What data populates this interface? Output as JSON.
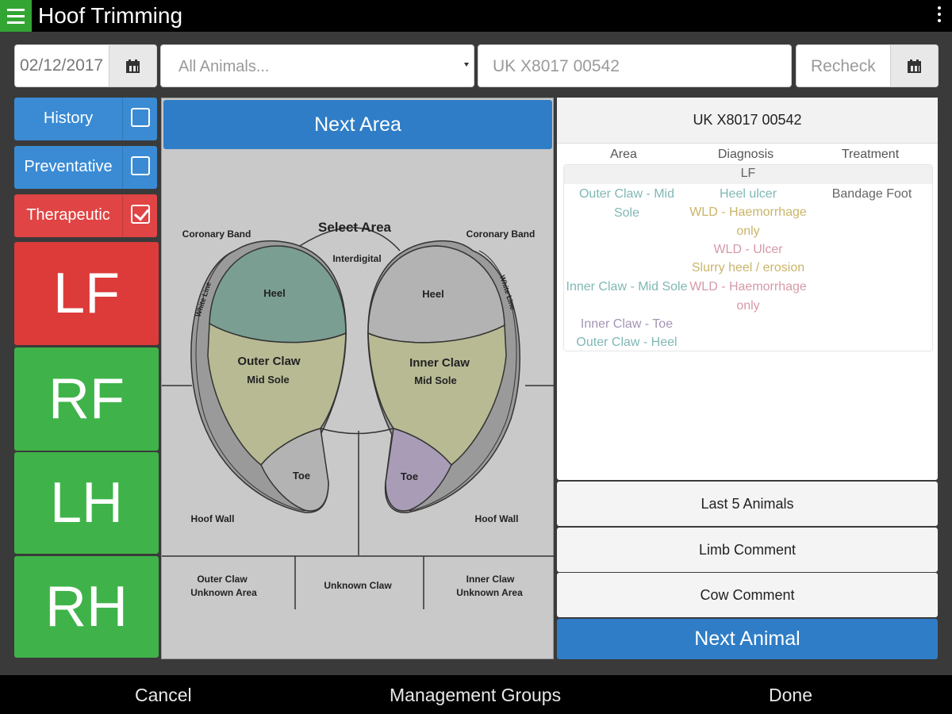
{
  "app": {
    "title": "Hoof Trimming"
  },
  "top_row": {
    "date_value": "02/12/2017",
    "animal_select_value": "All Animals...",
    "animal_id_value": "UK X8017 00542",
    "recheck_placeholder": "Recheck"
  },
  "categories": [
    {
      "label": "History",
      "checked": false
    },
    {
      "label": "Preventative",
      "checked": false
    },
    {
      "label": "Therapeutic",
      "checked": true
    }
  ],
  "limbs": [
    "LF",
    "RF",
    "LH",
    "RH"
  ],
  "diagram": {
    "next_area_label": "Next Area",
    "select_area": "Select Area",
    "coronary_band_left": "Coronary Band",
    "coronary_band_right": "Coronary Band",
    "interdigital": "Interdigital",
    "white_line_left": "White Line",
    "white_line_right": "White Line",
    "heel_left": "Heel",
    "heel_right": "Heel",
    "outer_claw": "Outer Claw",
    "inner_claw": "Inner Claw",
    "mid_sole_left": "Mid Sole",
    "mid_sole_right": "Mid Sole",
    "toe_left": "Toe",
    "toe_right": "Toe",
    "hoof_wall_left": "Hoof Wall",
    "hoof_wall_right": "Hoof Wall",
    "outer_unknown_1": "Outer Claw",
    "outer_unknown_2": "Unknown Area",
    "unknown_claw": "Unknown Claw",
    "inner_unknown_1": "Inner Claw",
    "inner_unknown_2": "Unknown Area",
    "colors": {
      "heel_left": "#7a9e92",
      "sole": "#b8ba94",
      "toe_right": "#a89cb6",
      "neutral": "#b3b3b3"
    }
  },
  "record": {
    "header": "UK X8017 00542",
    "columns": [
      "Area",
      "Diagnosis",
      "Treatment"
    ],
    "limb": "LF",
    "areas": {
      "a1_line1": "Outer Claw - Mid",
      "a1_line2": "Sole",
      "a2": "Inner Claw - Mid Sole",
      "a3": "Inner Claw - Toe",
      "a4": "Outer Claw - Heel"
    },
    "diagnoses": {
      "d1": "Heel ulcer",
      "d2_line1": "WLD - Haemorrhage",
      "d2_line2": "only",
      "d3": "WLD - Ulcer",
      "d4": "Slurry heel / erosion",
      "d5_line1": "WLD - Haemorrhage",
      "d5_line2": "only"
    },
    "treatment": "Bandage Foot"
  },
  "side_buttons": {
    "last5": "Last 5 Animals",
    "limb_comment": "Limb Comment",
    "cow_comment": "Cow Comment",
    "next_animal": "Next Animal"
  },
  "bottom_bar": {
    "cancel": "Cancel",
    "management_groups": "Management Groups",
    "done": "Done"
  }
}
